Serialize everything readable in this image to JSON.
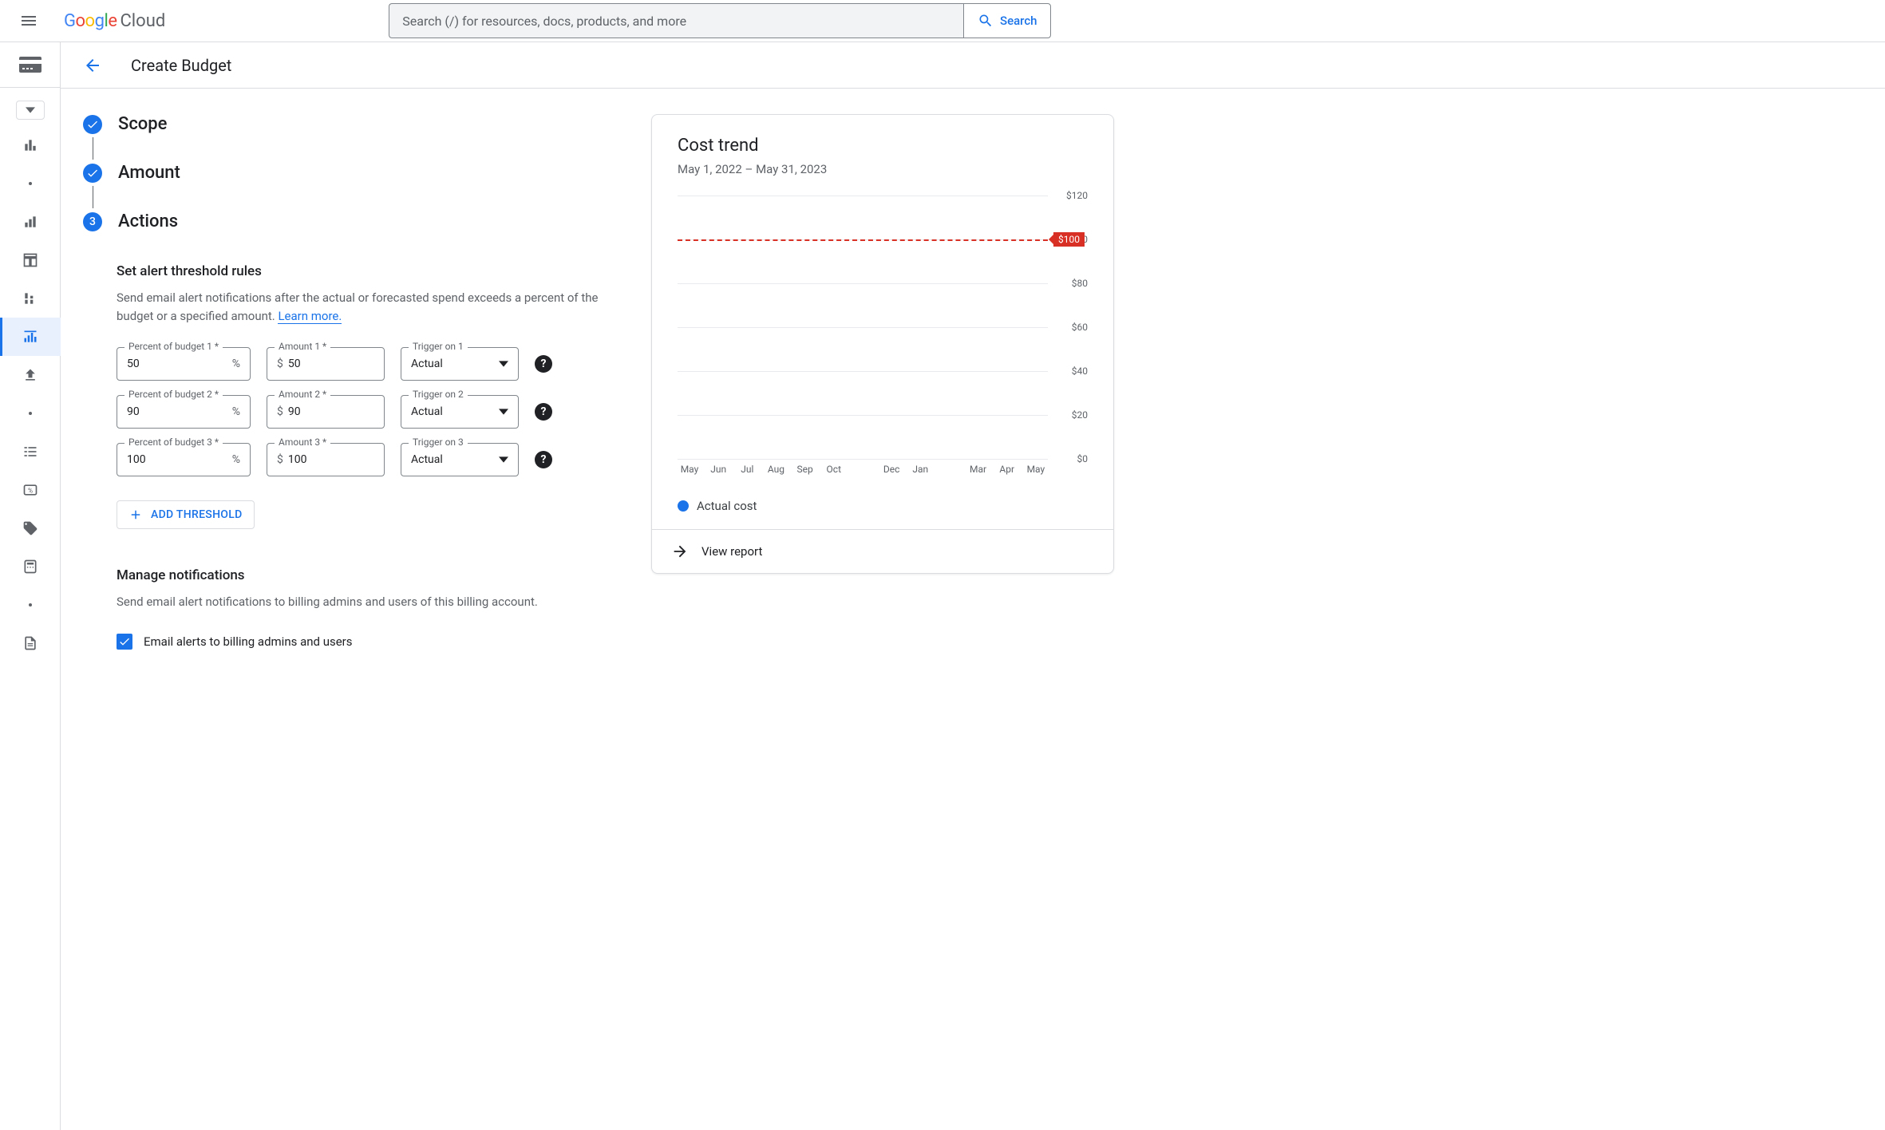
{
  "header": {
    "logo_google": "Google",
    "logo_cloud": "Cloud",
    "search_placeholder": "Search (/) for resources, docs, products, and more",
    "search_button": "Search"
  },
  "subheader": {
    "title": "Create Budget"
  },
  "stepper": {
    "step1": "Scope",
    "step2": "Amount",
    "step3_num": "3",
    "step3": "Actions"
  },
  "thresholds": {
    "title": "Set alert threshold rules",
    "desc": "Send email alert notifications after the actual or forecasted spend exceeds a percent of the budget or a specified amount. ",
    "learn_more": "Learn more.",
    "rows": [
      {
        "percent_label": "Percent of budget 1 *",
        "percent": "50",
        "amount_label": "Amount 1 *",
        "amount": "50",
        "trigger_label": "Trigger on 1",
        "trigger": "Actual"
      },
      {
        "percent_label": "Percent of budget 2 *",
        "percent": "90",
        "amount_label": "Amount 2 *",
        "amount": "90",
        "trigger_label": "Trigger on 2",
        "trigger": "Actual"
      },
      {
        "percent_label": "Percent of budget 3 *",
        "percent": "100",
        "amount_label": "Amount 3 *",
        "amount": "100",
        "trigger_label": "Trigger on 3",
        "trigger": "Actual"
      }
    ],
    "percent_suffix": "%",
    "dollar_prefix": "$",
    "add_button": "ADD THRESHOLD"
  },
  "notifications": {
    "title": "Manage notifications",
    "desc": "Send email alert notifications to billing admins and users of this billing account.",
    "checkbox_label": "Email alerts to billing admins and users"
  },
  "cost_trend": {
    "title": "Cost trend",
    "date_range": "May 1, 2022 – May 31, 2023",
    "budget_label": "$100",
    "legend": "Actual cost",
    "view_report": "View report"
  },
  "chart_data": {
    "type": "bar",
    "title": "Cost trend",
    "subtitle": "May 1, 2022 – May 31, 2023",
    "xlabel": "",
    "ylabel": "",
    "ylim": [
      0,
      120
    ],
    "y_ticks": [
      "$120",
      "$100",
      "$80",
      "$60",
      "$40",
      "$20",
      "$0"
    ],
    "categories": [
      "May",
      "Jun",
      "Jul",
      "Aug",
      "Sep",
      "Oct",
      "",
      "Dec",
      "Jan",
      "",
      "Mar",
      "Apr",
      "May"
    ],
    "series": [
      {
        "name": "Actual cost",
        "color": "#1a73e8",
        "values": [
          0,
          0,
          0,
          0,
          0,
          0,
          0,
          0,
          0,
          0,
          0,
          0,
          0
        ]
      }
    ],
    "annotations": [
      {
        "type": "hline",
        "value": 100,
        "label": "$100",
        "color": "#d93025",
        "style": "dashed"
      }
    ]
  }
}
